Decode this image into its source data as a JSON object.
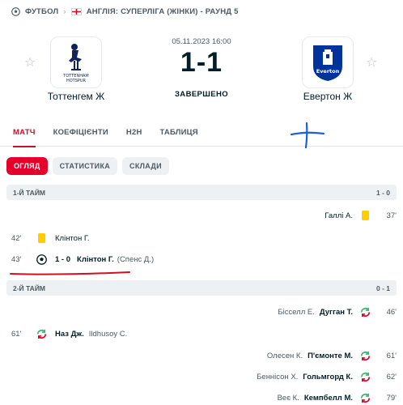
{
  "breadcrumb": {
    "sport": "ФУТБОЛ",
    "competition": "АНГЛІЯ: СУПЕРЛІГА (ЖІНКИ) - РАУНД 5"
  },
  "match": {
    "datetime": "05.11.2023 16:00",
    "score": "1-1",
    "status": "ЗАВЕРШЕНО",
    "home": {
      "name": "Тоттенгем Ж",
      "logo": "tottenham-crest-icon"
    },
    "away": {
      "name": "Евертон Ж",
      "logo": "everton-crest-icon"
    }
  },
  "tabs": [
    "МАТЧ",
    "КОЕФІЦІЄНТИ",
    "H2H",
    "ТАБЛИЦЯ"
  ],
  "subtabs": [
    "ОГЛЯД",
    "СТАТИСТИКА",
    "СКЛАДИ"
  ],
  "colors": {
    "accent": "#e4002b",
    "yellow_card": "#ffcd00",
    "annotation_blue": "#1f5fd6",
    "annotation_red": "#d0101a"
  },
  "first_half": {
    "label": "1-Й ТАЙМ",
    "score": "1 - 0",
    "events": [
      {
        "side": "away",
        "minute": "37'",
        "type": "yellow-card",
        "player": "Галлі А."
      },
      {
        "side": "home",
        "minute": "42'",
        "type": "yellow-card",
        "player": "Клінтон Г."
      },
      {
        "side": "home",
        "minute": "43'",
        "type": "goal",
        "score": "1 - 0",
        "player": "Клінтон Г.",
        "assist": "(Спенс Д.)"
      }
    ]
  },
  "second_half": {
    "label": "2-Й ТАЙМ",
    "score": "0 - 1",
    "events": [
      {
        "side": "away",
        "minute": "46'",
        "type": "substitution",
        "player_in": "Дугган Т.",
        "player_out": "Бісселл Е."
      },
      {
        "side": "home",
        "minute": "61'",
        "type": "substitution",
        "player_in": "Наз Дж.",
        "player_out": "Ildhusoy C."
      },
      {
        "side": "away",
        "minute": "61'",
        "type": "substitution",
        "player_in": "П'ємонте М.",
        "player_out": "Олесен К."
      },
      {
        "side": "away",
        "minute": "62'",
        "type": "substitution",
        "player_in": "Гольмгорд К.",
        "player_out": "Беннісон Х."
      },
      {
        "side": "away",
        "minute": "79'",
        "type": "substitution",
        "player_in": "Кемпбелл М.",
        "player_out": "Веє К."
      }
    ]
  }
}
